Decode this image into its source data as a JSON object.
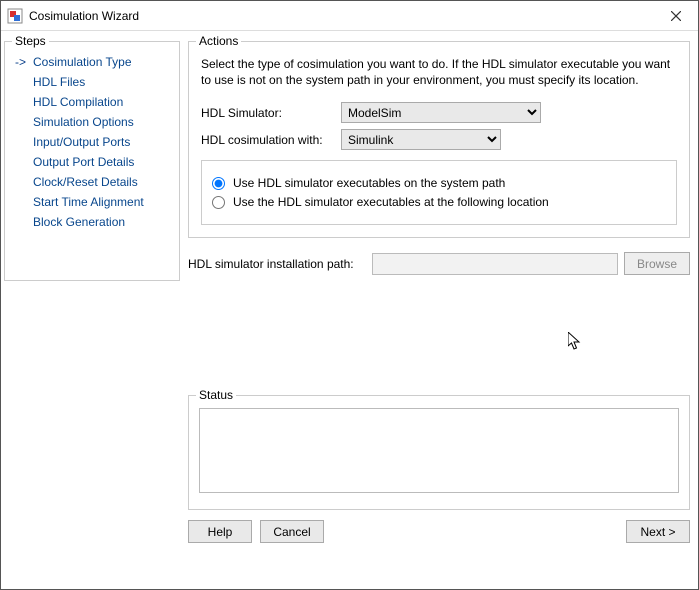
{
  "window": {
    "title": "Cosimulation Wizard"
  },
  "steps": {
    "legend": "Steps",
    "items": [
      {
        "label": "Cosimulation Type",
        "current": true
      },
      {
        "label": "HDL Files",
        "current": false
      },
      {
        "label": "HDL Compilation",
        "current": false
      },
      {
        "label": "Simulation Options",
        "current": false
      },
      {
        "label": "Input/Output Ports",
        "current": false
      },
      {
        "label": "Output Port Details",
        "current": false
      },
      {
        "label": "Clock/Reset Details",
        "current": false
      },
      {
        "label": "Start Time Alignment",
        "current": false
      },
      {
        "label": "Block Generation",
        "current": false
      }
    ]
  },
  "actions": {
    "legend": "Actions",
    "description": "Select the type of cosimulation you want to do. If the HDL simulator executable you want to use is not on the system path in your environment, you must specify its location.",
    "hdl_simulator_label": "HDL Simulator:",
    "hdl_simulator_value": "ModelSim",
    "cosim_with_label": "HDL cosimulation with:",
    "cosim_with_value": "Simulink",
    "radio_system_path": "Use HDL simulator executables on the system path",
    "radio_custom_path": "Use the HDL simulator executables at the following location",
    "install_path_label": "HDL simulator installation path:",
    "install_path_value": "",
    "browse_label": "Browse"
  },
  "status": {
    "legend": "Status",
    "text": ""
  },
  "buttons": {
    "help": "Help",
    "cancel": "Cancel",
    "next": "Next >"
  }
}
